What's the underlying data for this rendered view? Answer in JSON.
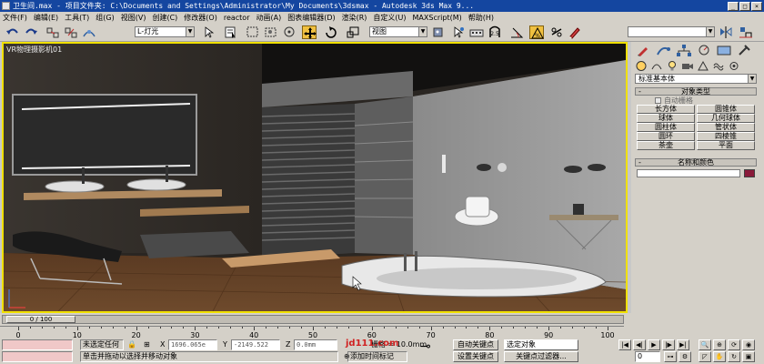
{
  "window": {
    "title": "卫生间.max    - 项目文件夹: C:\\Documents and Settings\\Administrator\\My Documents\\3dsmax    - Autodesk 3ds Max 9...",
    "buttons": {
      "minimize": "_",
      "maximize": "□",
      "close": "×"
    }
  },
  "menu": {
    "items": [
      "文件(F)",
      "编辑(E)",
      "工具(T)",
      "组(G)",
      "视图(V)",
      "创建(C)",
      "修改器(O)",
      "reactor",
      "动画(A)",
      "图表编辑器(D)",
      "渲染(R)",
      "自定义(U)",
      "MAXScript(M)",
      "帮助(H)"
    ]
  },
  "toolbar": {
    "selection_filter": "L-灯光",
    "ref_coord": "视图",
    "named_selection": ""
  },
  "viewport": {
    "label": "VR物理摄影机01"
  },
  "command_panel": {
    "category": "标准基本体",
    "rollout_object_type": "对象类型",
    "autogrid": "自动栅格",
    "objects": [
      "长方体",
      "圆锥体",
      "球体",
      "几何球体",
      "圆柱体",
      "管状体",
      "圆环",
      "四棱锥",
      "茶壶",
      "平面"
    ],
    "rollout_name_color": "名称和颜色",
    "rollout_sign": "-"
  },
  "timeline": {
    "frame_display": "0 / 100",
    "ticks": [
      "0",
      "10",
      "20",
      "30",
      "40",
      "50",
      "60",
      "70",
      "80",
      "90",
      "100"
    ]
  },
  "status": {
    "selection": "未选定任何",
    "x_label": "X",
    "x_value": "1696.065e",
    "y_label": "Y",
    "y_value": "-2149.522",
    "z_label": "Z",
    "z_value": "0.0mm",
    "grid": "栅格 = 10.0mm",
    "prompt": "单击并拖动以选择并移动对象",
    "add_time_tag": "添加时间标记",
    "auto_key": "自动关键点",
    "set_key": "设置关键点",
    "selected_object": "选定对象",
    "key_filters": "关键点过滤器...",
    "current_frame": "0",
    "watermark": "jd111.com"
  }
}
